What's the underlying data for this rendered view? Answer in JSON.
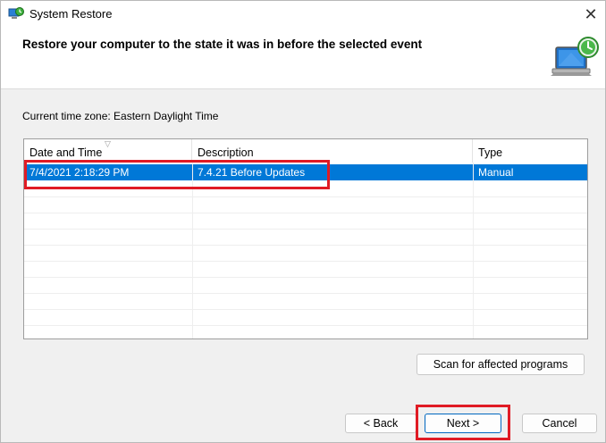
{
  "window": {
    "title": "System Restore",
    "close_glyph": "✕",
    "heading": "Restore your computer to the state it was in before the selected event",
    "icons": {
      "app": "system-restore-icon",
      "hero": "system-restore-computer-icon"
    }
  },
  "timezone_label": "Current time zone: Eastern Daylight Time",
  "table": {
    "columns": [
      "Date and Time",
      "Description",
      "Type"
    ],
    "sort_indicator": "▽",
    "rows": [
      {
        "date": "7/4/2021 2:18:29 PM",
        "description": "7.4.21 Before Updates",
        "type": "Manual",
        "selected": true
      }
    ]
  },
  "buttons": {
    "scan": "Scan for affected programs",
    "back": "< Back",
    "next": "Next >",
    "cancel": "Cancel"
  },
  "colors": {
    "selection": "#0078d7",
    "highlight_box": "#e01b24",
    "default_button_border": "#0067c0"
  }
}
